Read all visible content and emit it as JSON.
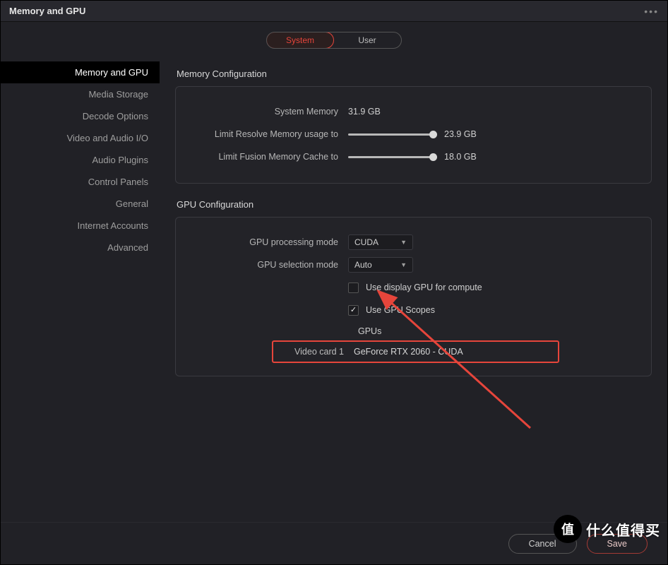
{
  "title": "Memory and GPU",
  "tabs": {
    "system": "System",
    "user": "User"
  },
  "sidebar": {
    "items": [
      "Memory and GPU",
      "Media Storage",
      "Decode Options",
      "Video and Audio I/O",
      "Audio Plugins",
      "Control Panels",
      "General",
      "Internet Accounts",
      "Advanced"
    ]
  },
  "memory": {
    "section": "Memory Configuration",
    "sysmem_label": "System Memory",
    "sysmem_value": "31.9 GB",
    "resolve_label": "Limit Resolve Memory usage to",
    "resolve_value": "23.9 GB",
    "fusion_label": "Limit Fusion Memory Cache to",
    "fusion_value": "18.0 GB"
  },
  "gpu": {
    "section": "GPU Configuration",
    "proc_label": "GPU processing mode",
    "proc_value": "CUDA",
    "sel_label": "GPU selection mode",
    "sel_value": "Auto",
    "chk_display": "Use display GPU for compute",
    "chk_scopes": "Use GPU Scopes",
    "gpus_heading": "GPUs",
    "card_label": "Video card 1",
    "card_value": "GeForce RTX 2060 - CUDA"
  },
  "footer": {
    "cancel": "Cancel",
    "save": "Save"
  },
  "watermark": "什么值得买",
  "annotation_color": "#e6453b"
}
